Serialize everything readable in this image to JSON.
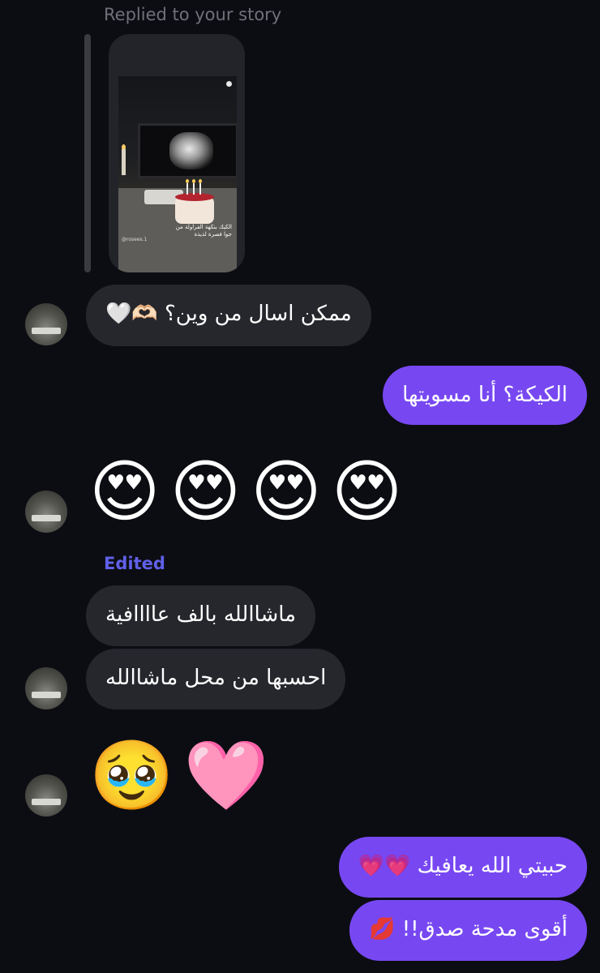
{
  "story_reply": {
    "caption": "Replied to your story",
    "story_overlay_text": "الكيك بنكهة الفراولة من جوا فصرة لذيذة",
    "story_handle": "@rosees.1"
  },
  "messages": [
    {
      "id": "m1",
      "side": "received",
      "text": "ممكن اسال من وين؟ 🫶🏻🤍"
    },
    {
      "id": "m2",
      "side": "sent",
      "text": "الكيكة؟ أنا مسويتها"
    },
    {
      "id": "m3",
      "side": "received",
      "emojis": [
        "😍",
        "😍",
        "😍",
        "😍"
      ]
    },
    {
      "id": "m4",
      "side": "received",
      "label": "Edited",
      "text": "ماشاالله بالف عاااافية"
    },
    {
      "id": "m5",
      "side": "received",
      "text": "احسبها من محل ماشاالله"
    },
    {
      "id": "m6",
      "side": "received",
      "emojis": [
        "🥹",
        "🩷"
      ]
    },
    {
      "id": "m7",
      "side": "sent",
      "text": "حبيتي الله يعافيك 💗💗"
    },
    {
      "id": "m8",
      "side": "sent",
      "text": "أقوى مدحة صدق!! 💋"
    }
  ],
  "colors": {
    "background": "#0c0d12",
    "received_bubble": "#26272d",
    "sent_bubble": "#7748f2",
    "edited_label": "#6060e8"
  },
  "icons": {
    "avatar": "user-avatar-photo"
  }
}
